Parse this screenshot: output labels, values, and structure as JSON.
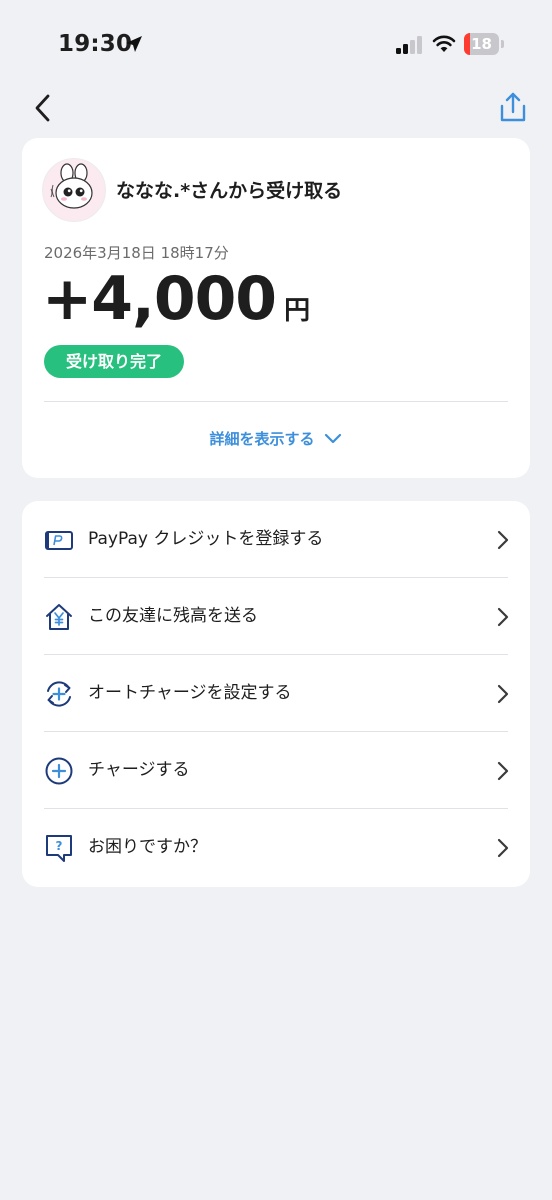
{
  "status_bar": {
    "time": "19:30",
    "battery_level": "18",
    "icons": [
      "location-arrow-icon",
      "cellular-signal-icon",
      "wifi-icon",
      "battery-icon"
    ]
  },
  "nav": {
    "back_icon": "chevron-left-icon",
    "share_icon": "share-icon"
  },
  "transaction": {
    "sender_label": "ななな.*さんから受け取る",
    "datetime": "2026年3月18日 18時17分",
    "amount": "+4,000",
    "currency": "円",
    "status": "受け取り完了",
    "details_toggle": "詳細を表示する"
  },
  "menu": {
    "items": [
      {
        "label": "PayPay クレジットを登録する",
        "icon": "credit-card-icon"
      },
      {
        "label": "この友達に残高を送る",
        "icon": "yen-house-icon"
      },
      {
        "label": "オートチャージを設定する",
        "icon": "auto-charge-icon"
      },
      {
        "label": "チャージする",
        "icon": "plus-circle-icon"
      },
      {
        "label": "お困りですか？",
        "icon": "help-question-icon"
      }
    ]
  },
  "colors": {
    "background": "#f0f1f5",
    "badge": "#28c07e",
    "link": "#3d8fdc",
    "icon_navy": "#1d3b7a"
  }
}
